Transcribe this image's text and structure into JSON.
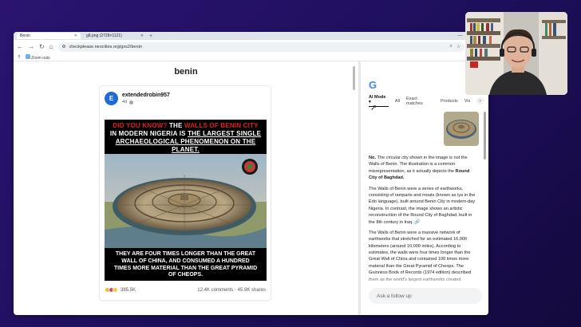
{
  "browser": {
    "tabs": [
      {
        "label": "Benin",
        "active": true
      },
      {
        "label": "g8.png (2728×1121)",
        "active": false
      }
    ],
    "url": "checkplease.neocities.org/gss2/benin",
    "bookmarks": [
      {
        "label": "Zoom outs"
      }
    ]
  },
  "page": {
    "title": "benin"
  },
  "post": {
    "avatar_letter": "E",
    "author": "extendedrobin957",
    "time": "4d",
    "meme": {
      "top_did": "DID YOU KNOW?",
      "top_the": "THE",
      "top_walls": "WALLS OF BENIN CITY",
      "top_line2a": "IN MODERN NIGERIA IS",
      "top_line2b": "THE LARGEST SINGLE",
      "top_line3": "ARCHAEOLOGICAL PHENOMENON ON THE",
      "top_line4": "PLANET.",
      "bottom_line1": "THEY ARE FOUR TIMES LONGER THAN THE GREAT",
      "bottom_line2": "WALL OF CHINA, AND CONSUMED A HUNDRED",
      "bottom_line3": "TIMES MORE MATERIAL THAN THE GREAT PYRAMID",
      "bottom_line4": "OF CHEOPS."
    },
    "reactions_count": "385.5K",
    "comments": "12.4K comments",
    "shares": "45.9K shares",
    "stats_separator": "·"
  },
  "search": {
    "logo": "G",
    "tabs": [
      "AI Mode",
      "All",
      "Exact matches",
      "Products",
      "Vis"
    ],
    "answer": {
      "p1_bold": "No.",
      "p1_text": "The circular city shown in the image is not the Walls of Benin. The illustration is a common misrepresentation, as it actually depicts the",
      "p1_bold2": "Round City of Baghdad.",
      "p2": "The Walls of Benin were a series of earthworks, consisting of ramparts and moats (known as iya in the Edo language), built around Benin City in modern-day Nigeria. In contrast, the image shows an artistic reconstruction of the Round City of Baghdad, built in the 8th century in Iraq.",
      "p3": "The Walls of Benin were a massive network of earthworks that stretched for an estimated 16,000 kilometers (around 10,000 miles). According to estimates, the walls were four times longer than the Great Wall of China and contained 100 times more material than the Great Pyramid of Cheops. The Guinness Book of Records (1974 edition) described them as the world's largest earthworks created"
    },
    "followup_placeholder": "Ask a follow up"
  },
  "colors": {
    "background": "#24116a",
    "meme_red": "#e11f1f",
    "avatar_blue": "#1f6ad6"
  }
}
